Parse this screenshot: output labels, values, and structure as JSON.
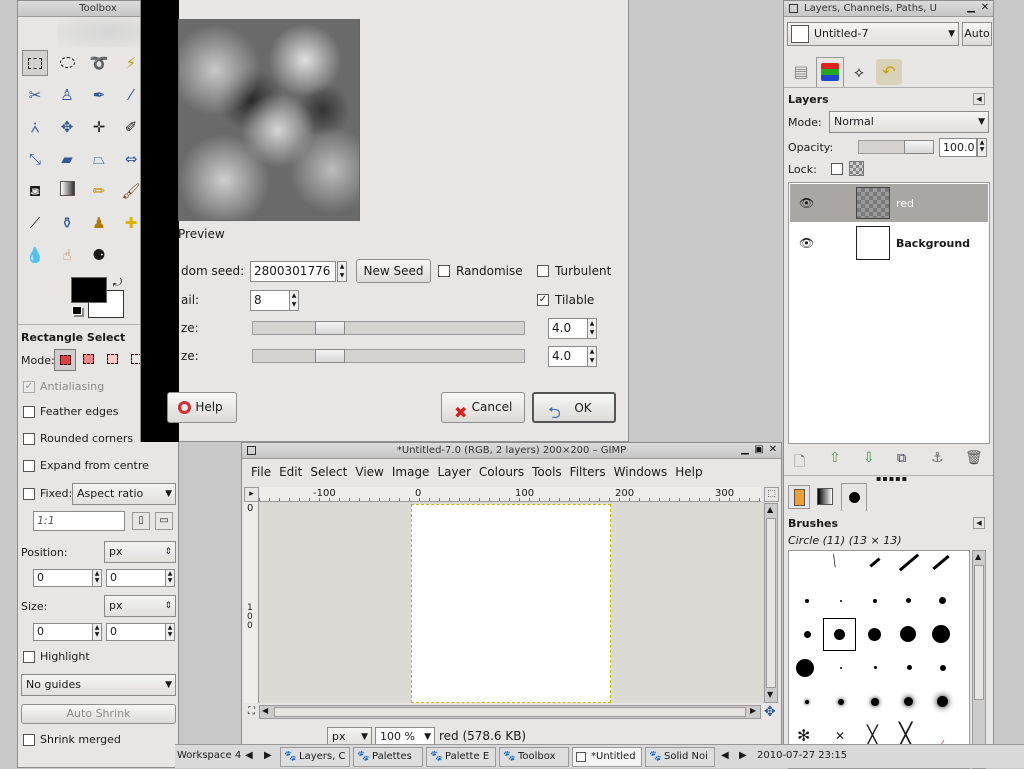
{
  "toolbox": {
    "title": "Toolbox",
    "tool_options_title": "Rectangle Select",
    "mode_label": "Mode:",
    "antialiasing": "Antialiasing",
    "feather_edges": "Feather edges",
    "rounded_corners": "Rounded corners",
    "expand_from_centre": "Expand from centre",
    "fixed_label": "Fixed:",
    "fixed_value": "Aspect ratio",
    "ratio_value": "1:1",
    "position_label": "Position:",
    "position_unit": "px",
    "pos_x": "0",
    "pos_y": "0",
    "size_label": "Size:",
    "size_unit": "px",
    "size_w": "0",
    "size_h": "0",
    "highlight": "Highlight",
    "guides": "No guides",
    "auto_shrink": "Auto Shrink",
    "shrink_merged": "Shrink merged"
  },
  "solid_noise_dialog": {
    "preview_label": "Preview",
    "random_seed_label": "dom seed:",
    "random_seed_value": "2800301776",
    "new_seed_label": "New Seed",
    "randomise_label": "Randomise",
    "turbulent_label": "Turbulent",
    "detail_label": "ail:",
    "detail_value": "8",
    "tilable_label": "Tilable",
    "x_size_label": "ze:",
    "x_size_value": "4.0",
    "y_size_label": "ze:",
    "y_size_value": "4.0",
    "x_size_fraction": 0.25,
    "y_size_fraction": 0.25,
    "help_label": "Help",
    "cancel_label": "Cancel",
    "ok_label": "OK"
  },
  "image_window": {
    "title": "*Untitled-7.0 (RGB, 2 layers) 200×200 – GIMP",
    "menu": [
      "File",
      "Edit",
      "Select",
      "View",
      "Image",
      "Layer",
      "Colours",
      "Tools",
      "Filters",
      "Windows",
      "Help"
    ],
    "ruler_h": [
      "-100",
      "0",
      "100",
      "200",
      "300"
    ],
    "ruler_v": [
      "0",
      "100"
    ],
    "unit": "px",
    "zoom": "100 %",
    "status": "red (578.6 KB)"
  },
  "layers_dock": {
    "title": "Layers, Channels, Paths, U",
    "image_select": "Untitled-7",
    "auto_label": "Auto",
    "panel_title": "Layers",
    "mode_label": "Mode:",
    "mode_value": "Normal",
    "opacity_label": "Opacity:",
    "opacity_value": "100.0",
    "lock_label": "Lock:",
    "layers": [
      {
        "name": "red"
      },
      {
        "name": "Background"
      }
    ],
    "brushes_title": "Brushes",
    "brush_name": "Circle (11) (13 × 13)"
  },
  "taskbar": {
    "workspace": "Workspace 4",
    "tasks": [
      "Layers, C",
      "Palettes",
      "Palette E",
      "Toolbox",
      "*Untitled",
      "Solid Noi"
    ],
    "clock": "2010-07-27 23:15"
  },
  "colors": {
    "foreground": "#000000",
    "background": "#ffffff",
    "selection_row": "#a9a7a3"
  }
}
